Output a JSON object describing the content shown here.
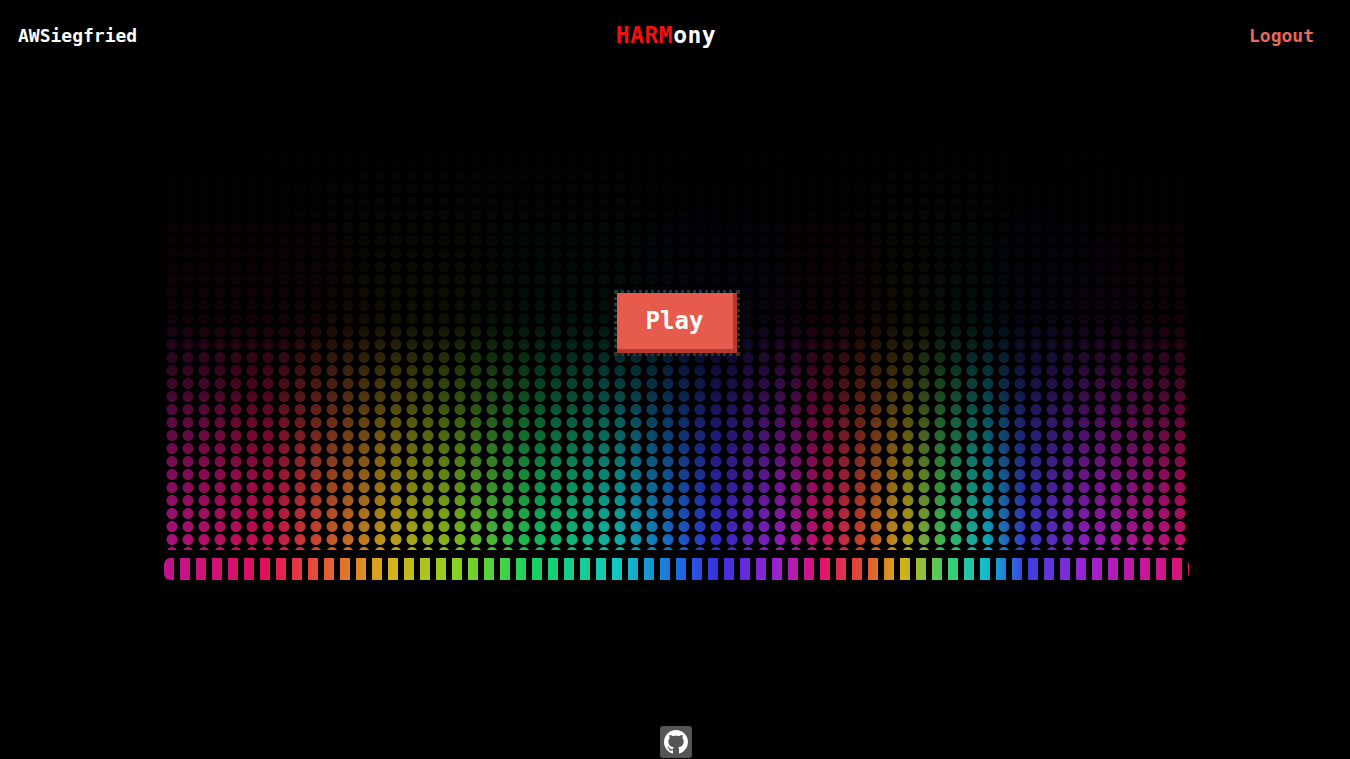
{
  "header": {
    "username": "AWSiegfried",
    "logo": {
      "accent": "HARM",
      "rest": "ony"
    },
    "logout": "Logout"
  },
  "hero": {
    "play_button": "Play"
  }
}
